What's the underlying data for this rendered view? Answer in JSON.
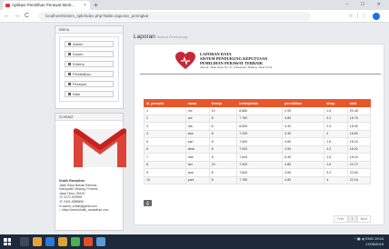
{
  "browser": {
    "tab_title": "Aplikasi Pemilihan Perawat Ment...",
    "url": "localhost/sistem_spk/index.php?table=laporan_peringkat",
    "nav_back": "←",
    "nav_forward": "→",
    "nav_reload": "C",
    "close": "×",
    "new_tab": "+",
    "window_controls": "– ☐ ✕",
    "toolbar_icons": "☆ ⋮ ⋮"
  },
  "sidebar": {
    "menu_header": "Menu",
    "items": [
      {
        "label": "Admin"
      },
      {
        "label": "Dosen"
      },
      {
        "label": "Kriteria"
      },
      {
        "label": "Pendidikan"
      },
      {
        "label": "Perawat"
      },
      {
        "label": "Nilai"
      }
    ],
    "contact_header": "Contact",
    "contact_lines": [
      "Khalik Ramadhan",
      "Jalan Raya Basuki Rahmat,",
      "Kabupaten Malang, Provinsi",
      "Jawa Timur, 65152",
      "☏ 0271-629998",
      "☏ 0341-5585896",
      "✉ admin_email@gmail.com",
      "⌂ https://www.khalik_ramadhan.com"
    ]
  },
  "main": {
    "title": "Laporan",
    "subtitle": "Sistem Pendukung",
    "report_title_1": "LAPORAN DATA",
    "report_title_2": "SISTEM PENDUKUNG KEPUTUSAN",
    "report_title_3": "PEMILIHAN PERAWAT TERBAIK",
    "report_address": "Alamat: Jalan Raya No. 27, Kabupaten Malang, Jawa Timur",
    "print_label": "⎙",
    "table": {
      "headers": [
        "id_perawat",
        "nama",
        "kinerja",
        "kedisiplinan",
        "pendidikan",
        "sikap",
        "total"
      ],
      "rows": [
        [
          "1",
          "rini",
          "10",
          "8.880",
          "2.90",
          "1.6",
          "20.48"
        ],
        [
          "2",
          "ani",
          "8",
          "7.760",
          "4.80",
          "3.2",
          "18.76"
        ],
        [
          "3",
          "rita",
          "8",
          "8.600",
          "3.40",
          "2.4",
          "18.40"
        ],
        [
          "4",
          "eka",
          "8",
          "7.200",
          "3.30",
          "4",
          "18.60"
        ],
        [
          "5",
          "sari",
          "8",
          "7.840",
          "4.80",
          "1.6",
          "18.24"
        ],
        [
          "6",
          "dewi",
          "8",
          "7.920",
          "2.90",
          "3.2",
          "18.02"
        ],
        [
          "7",
          "mia",
          "8",
          "7.640",
          "6.30",
          "1.6",
          "18.24"
        ],
        [
          "8",
          "tari",
          "10",
          "7.920",
          "4.80",
          "1.6",
          "24.72"
        ],
        [
          "9",
          "ana",
          "8",
          "7.840",
          "3.60",
          "3.2",
          "22.64"
        ],
        [
          "10",
          "yani",
          "8",
          "7.760",
          "4.80",
          "4",
          "22.16"
        ]
      ]
    },
    "pager": {
      "prev": "Prev",
      "page": "1",
      "next": "Next"
    }
  },
  "taskbar": {
    "time": "19:24",
    "date": "17/05/2019",
    "tray_icons": "^ ▣ ◂) ENG"
  }
}
